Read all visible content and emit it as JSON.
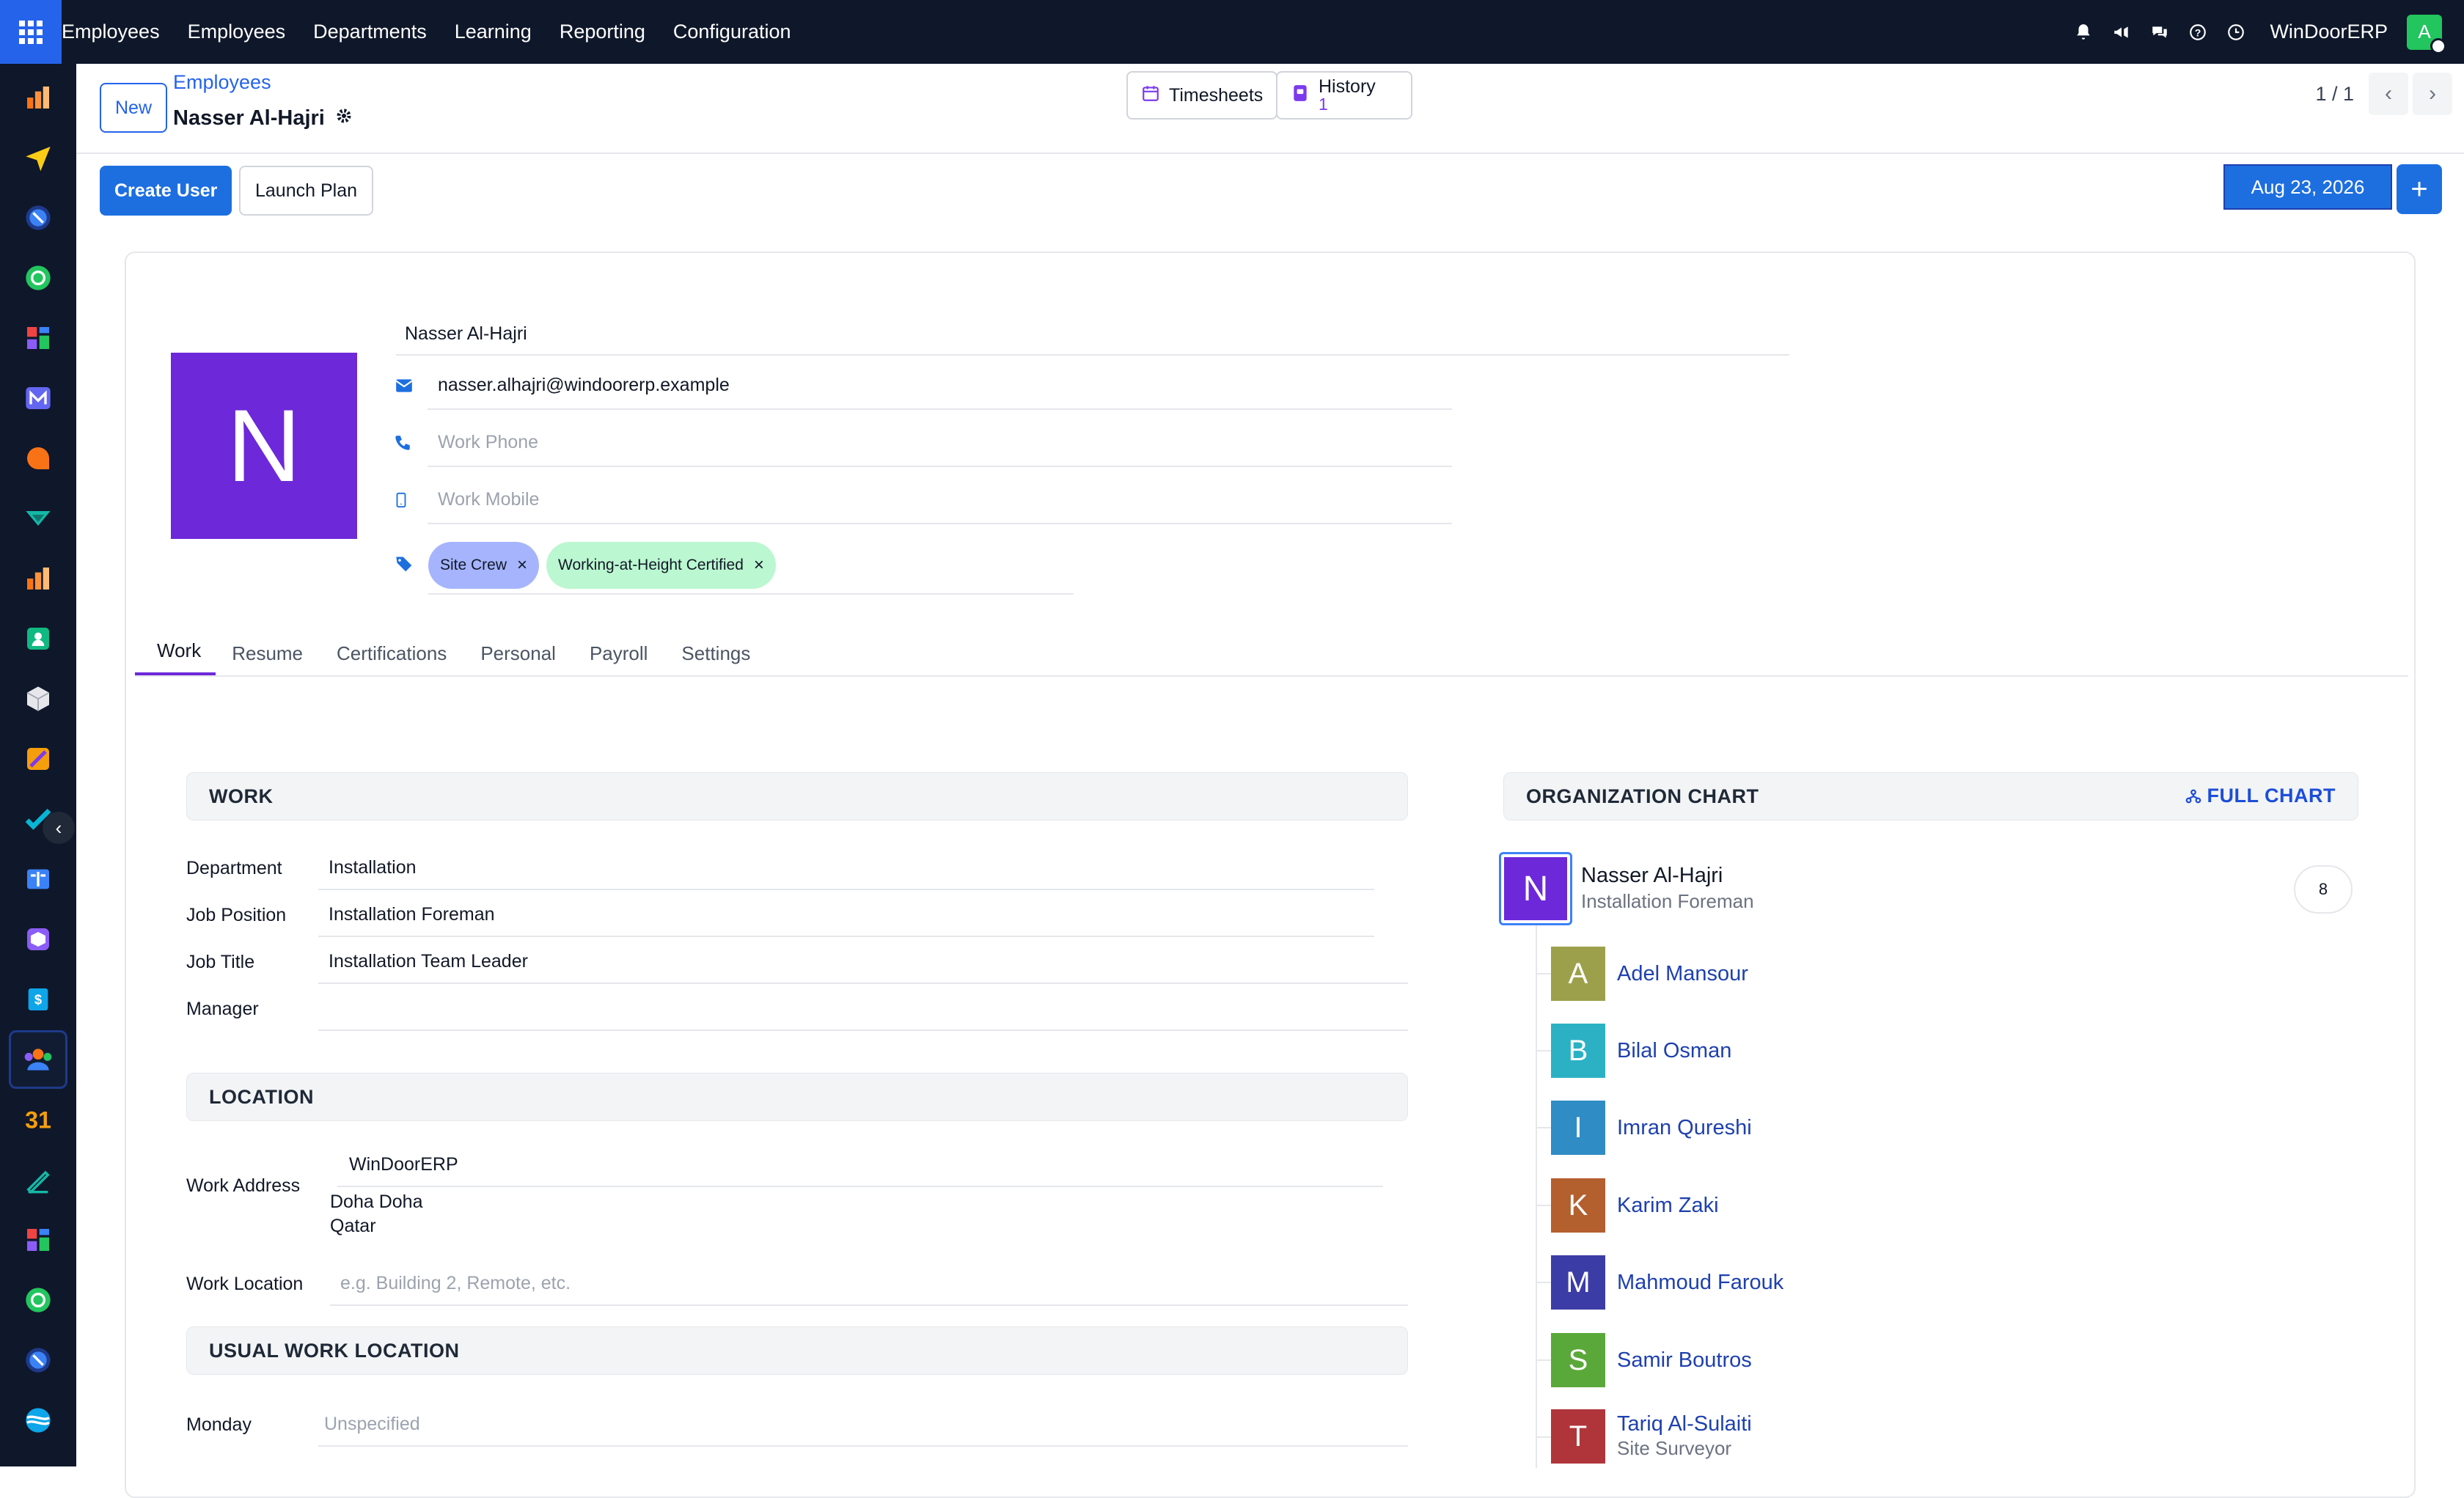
{
  "topbar": {
    "app_name": "Employees",
    "menu": [
      "Employees",
      "Departments",
      "Learning",
      "Reporting",
      "Configuration"
    ],
    "company": "WinDoorERP",
    "user_initial": "A"
  },
  "control_panel": {
    "new_label": "New",
    "breadcrumb_parent": "Employees",
    "breadcrumb_current": "Nasser Al-Hajri",
    "timesheets_label": "Timesheets",
    "history_label": "History",
    "history_count": "1",
    "pager": "1 / 1"
  },
  "actions": {
    "create_user": "Create User",
    "launch_plan": "Launch Plan",
    "date": "Aug 23, 2026",
    "plus": "+"
  },
  "employee": {
    "initial": "N",
    "name": "Nasser Al-Hajri",
    "email": "nasser.alhajri@windoorerp.example",
    "work_phone_placeholder": "Work Phone",
    "work_mobile_placeholder": "Work Mobile",
    "tags": [
      {
        "label": "Site Crew",
        "color": "#a5b4fc"
      },
      {
        "label": "Working-at-Height Certified",
        "color": "#bbf7d0"
      }
    ]
  },
  "tabs": [
    "Work",
    "Resume",
    "Certifications",
    "Personal",
    "Payroll",
    "Settings"
  ],
  "work_section": {
    "title": "WORK",
    "fields": [
      {
        "label": "Department",
        "value": "Installation"
      },
      {
        "label": "Job Position",
        "value": "Installation Foreman"
      },
      {
        "label": "Job Title",
        "value": "Installation Team Leader"
      },
      {
        "label": "Manager",
        "value": ""
      }
    ]
  },
  "location_section": {
    "title": "LOCATION",
    "work_address_label": "Work Address",
    "work_address_value": "WinDoorERP",
    "address_line1": "Doha Doha",
    "address_line2": "Qatar",
    "work_location_label": "Work Location",
    "work_location_placeholder": "e.g. Building 2, Remote, etc."
  },
  "usual_section": {
    "title": "USUAL WORK LOCATION",
    "rows": [
      {
        "label": "Monday",
        "value": "Unspecified"
      }
    ]
  },
  "org_chart": {
    "title": "ORGANIZATION CHART",
    "full_chart": "FULL CHART",
    "main": {
      "initial": "N",
      "name": "Nasser Al-Hajri",
      "job": "Installation Foreman",
      "count": "8"
    },
    "subordinates": [
      {
        "initial": "A",
        "name": "Adel Mansour",
        "job": "",
        "color": "#9ca04a"
      },
      {
        "initial": "B",
        "name": "Bilal Osman",
        "job": "",
        "color": "#2cb1c4"
      },
      {
        "initial": "I",
        "name": "Imran Qureshi",
        "job": "",
        "color": "#2f8cc4"
      },
      {
        "initial": "K",
        "name": "Karim Zaki",
        "job": "",
        "color": "#b45f2e"
      },
      {
        "initial": "M",
        "name": "Mahmoud Farouk",
        "job": "",
        "color": "#3c3ca6"
      },
      {
        "initial": "S",
        "name": "Samir Boutros",
        "job": "",
        "color": "#5aa83a"
      },
      {
        "initial": "T",
        "name": "Tariq Al-Sulaiti",
        "job": "Site Surveyor",
        "color": "#b0353a"
      }
    ]
  }
}
